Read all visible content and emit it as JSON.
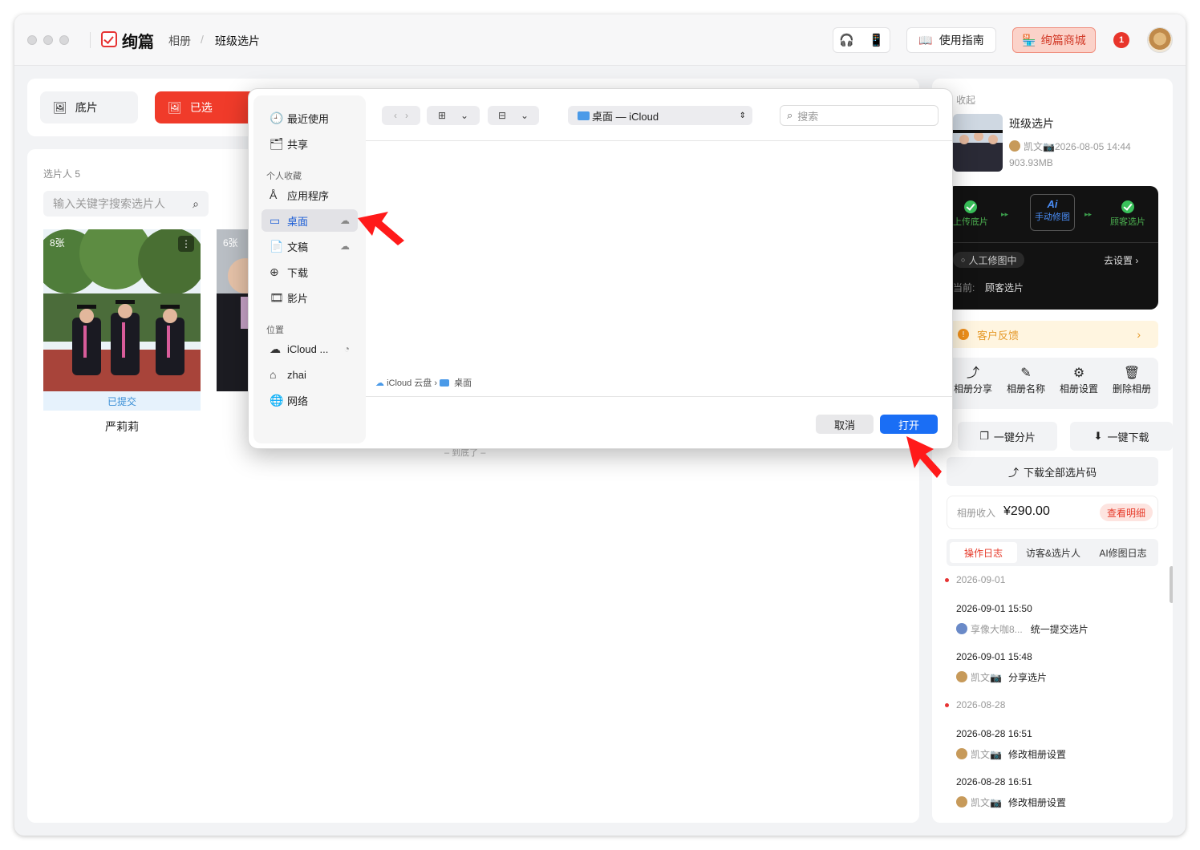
{
  "app": {
    "logo": "绚篇",
    "breadcrumb": [
      "相册",
      "班级选片"
    ],
    "top_buttons": {
      "guide": "使用指南",
      "shop": "绚篇商城"
    },
    "notification_badge": "1"
  },
  "left": {
    "tabs": [
      {
        "label": "底片"
      },
      {
        "label": "已选"
      }
    ],
    "selector_count_label": "选片人 5",
    "search_placeholder": "输入关键字搜索选片人",
    "cards": [
      {
        "count": "8张",
        "status": "已提交",
        "name": "严莉莉"
      },
      {
        "count": "6张"
      }
    ],
    "end_text": "– 到底了 –"
  },
  "right": {
    "collapse": "收起",
    "album": {
      "title": "班级选片",
      "meta": "凯文📷2026-08-05 14:44",
      "size": "903.93MB"
    },
    "workflow": {
      "steps": [
        "上传底片",
        "手动修图",
        "顾客选片"
      ],
      "ai_label": "Ai",
      "status": "人工修图中",
      "settings_link": "去设置 ›",
      "current_label": "当前:",
      "current_value": "顾客选片"
    },
    "feedback": "客户反馈",
    "actions": [
      "相册分享",
      "相册名称",
      "相册设置",
      "删除相册"
    ],
    "one_click_split": "一键分片",
    "one_click_download": "一键下载",
    "download_codes": "下载全部选片码",
    "income": {
      "label": "相册收入",
      "value": "¥290.00",
      "detail": "查看明细"
    },
    "log_tabs": [
      "操作日志",
      "访客&选片人",
      "AI修图日志"
    ],
    "logs": [
      {
        "date": "2026-09-01"
      },
      {
        "time": "2026-09-01 15:50",
        "user": "享像大咖8...",
        "action": "统一提交选片"
      },
      {
        "time": "2026-09-01 15:48",
        "user": "凯文📷",
        "action": "分享选片"
      },
      {
        "date": "2026-08-28"
      },
      {
        "time": "2026-08-28 16:51",
        "user": "凯文📷",
        "action": "修改相册设置"
      },
      {
        "time": "2026-08-28 16:51",
        "user": "凯文📷",
        "action": "修改相册设置"
      }
    ]
  },
  "dialog": {
    "sidebar": {
      "items_top": [
        {
          "label": "最近使用",
          "icon": "clock-icon"
        },
        {
          "label": "共享",
          "icon": "shared-folder-icon"
        }
      ],
      "favorites_header": "个人收藏",
      "favorites": [
        {
          "label": "应用程序",
          "icon": "apps-icon"
        },
        {
          "label": "桌面",
          "icon": "desktop-icon"
        },
        {
          "label": "文稿",
          "icon": "document-icon"
        },
        {
          "label": "下载",
          "icon": "download-icon"
        },
        {
          "label": "影片",
          "icon": "film-icon"
        }
      ],
      "locations_header": "位置",
      "locations": [
        {
          "label": "iCloud ...",
          "icon": "cloud-icon"
        },
        {
          "label": "zhai",
          "icon": "home-icon"
        },
        {
          "label": "网络",
          "icon": "globe-icon"
        }
      ]
    },
    "location": "桌面 — iCloud",
    "search_placeholder": "搜索",
    "path": [
      "iCloud 云盘",
      "桌面"
    ],
    "cancel": "取消",
    "open": "打开"
  },
  "colors": {
    "accent": "#f03b2a",
    "primary_blue": "#1a6ef5",
    "annotation_arrow": "#ff1a1a"
  }
}
